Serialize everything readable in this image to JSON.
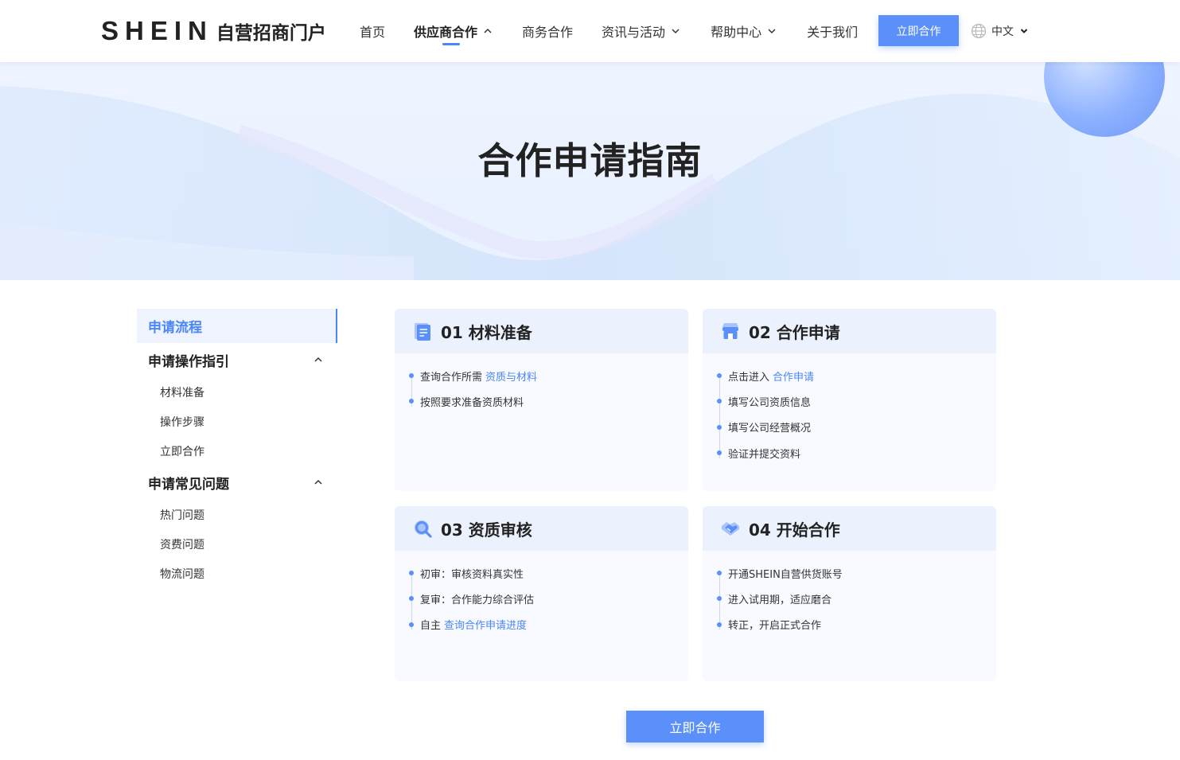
{
  "header": {
    "brand": "SHEIN",
    "portal": "自营招商门户",
    "nav": [
      {
        "label": "首页",
        "has_chevron": false
      },
      {
        "label": "供应商合作",
        "has_chevron": true,
        "active": true
      },
      {
        "label": "商务合作",
        "has_chevron": false
      },
      {
        "label": "资讯与活动",
        "has_chevron": true
      },
      {
        "label": "帮助中心",
        "has_chevron": true
      },
      {
        "label": "关于我们",
        "has_chevron": false
      }
    ],
    "cta_label": "立即合作",
    "language": "中文"
  },
  "banner": {
    "title": "合作申请指南"
  },
  "sidebar": {
    "top_item": "申请流程",
    "groups": [
      {
        "label": "申请操作指引",
        "items": [
          "材料准备",
          "操作步骤",
          "立即合作"
        ]
      },
      {
        "label": "申请常见问题",
        "items": [
          "热门问题",
          "资费问题",
          "物流问题"
        ]
      }
    ]
  },
  "cards": [
    {
      "title": "01 材料准备",
      "icon": "document-icon",
      "items": [
        {
          "text": "查询合作所需",
          "link": "资质与材料"
        },
        {
          "text": "按照要求准备资质材料",
          "link": ""
        }
      ]
    },
    {
      "title": "02 合作申请",
      "icon": "store-icon",
      "items": [
        {
          "text": "点击进入",
          "link": "合作申请"
        },
        {
          "text": "填写公司资质信息",
          "link": ""
        },
        {
          "text": "填写公司经营概况",
          "link": ""
        },
        {
          "text": "验证并提交资料",
          "link": ""
        }
      ]
    },
    {
      "title": "03 资质审核",
      "icon": "magnifier-icon",
      "items": [
        {
          "text": "初审：审核资料真实性",
          "link": ""
        },
        {
          "text": "复审：合作能力综合评估",
          "link": ""
        },
        {
          "text": "自主",
          "link": "查询合作申请进度"
        }
      ]
    },
    {
      "title": "04 开始合作",
      "icon": "handshake-icon",
      "items": [
        {
          "text": "开通SHEIN自营供货账号",
          "link": ""
        },
        {
          "text": "进入试用期，适应磨合",
          "link": ""
        },
        {
          "text": "转正，开启正式合作",
          "link": ""
        }
      ]
    }
  ],
  "bottom_cta_label": "立即合作",
  "colors": {
    "accent": "#5b8ff9",
    "link": "#4a86f4",
    "card_head": "#ebf1fd"
  }
}
